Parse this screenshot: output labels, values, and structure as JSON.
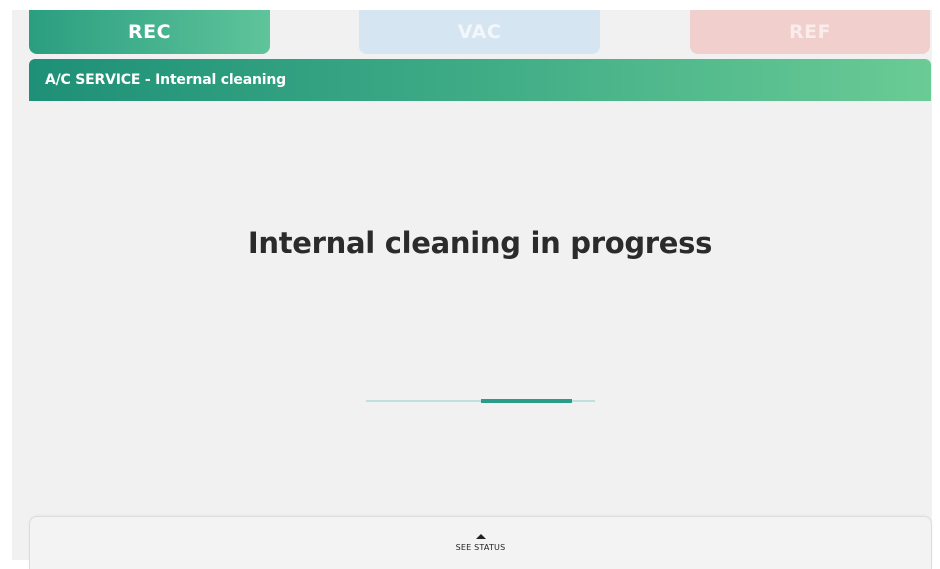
{
  "tabs": {
    "rec": {
      "label": "REC",
      "state": "active",
      "color": "#2a9e80"
    },
    "vac": {
      "label": "VAC",
      "state": "inactive",
      "color": "#d6e5f2"
    },
    "ref": {
      "label": "REF",
      "state": "inactive",
      "color": "#f0cfcc"
    }
  },
  "header": {
    "title": "A/C SERVICE - Internal cleaning",
    "color": "#3fac86"
  },
  "main": {
    "status_message": "Internal cleaning in progress",
    "progress": {
      "indeterminate": true,
      "track_color": "#bfe0dc",
      "fill_color": "#2b9c8a"
    }
  },
  "bottom_panel": {
    "label": "SEE STATUS",
    "icon": "chevron-up-icon"
  }
}
